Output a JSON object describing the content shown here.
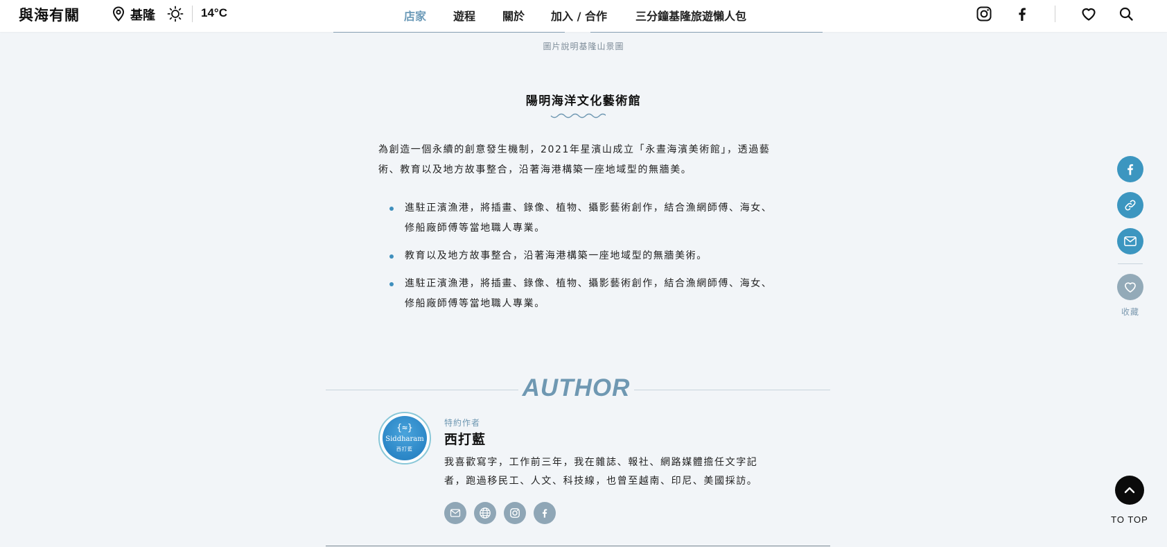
{
  "header": {
    "logo": "與海有關",
    "location": "基隆",
    "temperature": "14°C",
    "nav": [
      {
        "label": "店家",
        "active": true
      },
      {
        "label": "遊程",
        "active": false
      },
      {
        "label": "關於",
        "active": false
      },
      {
        "label": "加入 / 合作",
        "active": false
      },
      {
        "label": "三分鐘基隆旅遊懶人包",
        "active": false
      }
    ],
    "icons": [
      "instagram-icon",
      "facebook-icon",
      "heart-icon",
      "search-icon"
    ]
  },
  "article": {
    "image_caption": "圖片說明基隆山景圖",
    "section_title": "陽明海洋文化藝術館",
    "paragraph": "為創造一個永續的創意發生機制，2021年星濱山成立「永晝海濱美術館」，透過藝術、教育以及地方故事整合，沿著海港構築一座地域型的無牆美。",
    "bullets": [
      "進駐正濱漁港，將插畫、錄像、植物、攝影藝術創作，結合漁網師傅、海女、修船廠師傅等當地職人專業。",
      "教育以及地方故事整合，沿著海港構築一座地域型的無牆美術。",
      "進駐正濱漁港，將插畫、錄像、植物、攝影藝術創作，結合漁網師傅、海女、修船廠師傅等當地職人專業。"
    ]
  },
  "author": {
    "heading": "AUTHOR",
    "avatar_glyph": "{≈}",
    "avatar_brand": "Siddharam",
    "avatar_sub": "西打藍",
    "role": "特約作者",
    "name": "西打藍",
    "bio": "我喜歡寫字，工作前三年，我在雜誌、報社、網路媒體擔任文字記者，跑過移民工、人文、科技線，也曾至越南、印尼、美國採訪。",
    "social_icons": [
      "mail-icon",
      "globe-icon",
      "instagram-icon",
      "facebook-icon"
    ]
  },
  "side_rail": {
    "share_icons": [
      "facebook-icon",
      "link-icon",
      "mail-icon"
    ],
    "favorite_label": "收藏",
    "to_top_label": "TO TOP"
  },
  "colors": {
    "accent": "#3c96c0",
    "nav_active": "#6b9ab8",
    "author_heading": "#6f98b2",
    "background": "#f2f5f8"
  }
}
